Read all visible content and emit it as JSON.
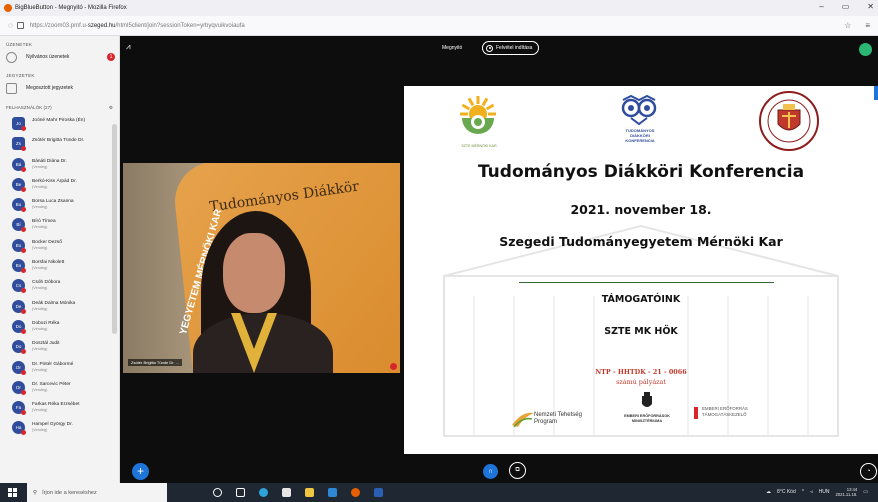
{
  "browser": {
    "window_title": "BigBlueButton - Megnyitó - Mozilla Firefox",
    "url_prefix": "https://",
    "url_host_pre": "zoom03.pmf.u-",
    "url_host": "szeged.hu",
    "url_path": "/html5client/join?sessionToken=yrbyqvuikvoiaufa"
  },
  "sidebar": {
    "messages_title": "ÜZENETEK",
    "public_chat_label": "Nyilvános üzenetek",
    "public_chat_badge": "1",
    "notes_title": "JEGYZETEK",
    "shared_notes_label": "Megosztott jegyzetek",
    "users_title": "FELHASZNÁLÓK (27)",
    "users": [
      {
        "initials": "Jo",
        "name": "Joóné Mahr Piroska (Én)",
        "role": "",
        "square": true
      },
      {
        "initials": "Zs",
        "name": "Zsótér Brigitta Tünde Dr.",
        "role": "",
        "square": true
      },
      {
        "initials": "Bá",
        "name": "Bánáti Diána Dr.",
        "role": "(Vendég)",
        "square": false
      },
      {
        "initials": "Be",
        "name": "Berkó-Kiss Árpád Dr.",
        "role": "(Vendég)",
        "square": false
      },
      {
        "initials": "Bo",
        "name": "Borsa Luca Zsanna",
        "role": "(Vendég)",
        "square": false
      },
      {
        "initials": "Bí",
        "name": "Bíró Tímea",
        "role": "(Vendég)",
        "square": false
      },
      {
        "initials": "Bo",
        "name": "Bocker Dezső",
        "role": "(Vendég)",
        "square": false
      },
      {
        "initials": "Bo",
        "name": "Borsfai Nikolett",
        "role": "(Vendég)",
        "square": false
      },
      {
        "initials": "Cs",
        "name": "Csóh Dóbora",
        "role": "(Vendég)",
        "square": false
      },
      {
        "initials": "De",
        "name": "Deák Dalma Mónika",
        "role": "(Vendég)",
        "square": false
      },
      {
        "initials": "Do",
        "name": "Dobozi Réka",
        "role": "(Vendég)",
        "square": false
      },
      {
        "initials": "Do",
        "name": "Dosztál Judit",
        "role": "(Vendég)",
        "square": false
      },
      {
        "initials": "Dr",
        "name": "Dr. Pintér Gábormé",
        "role": "(Vendég)",
        "square": false
      },
      {
        "initials": "Dr",
        "name": "Dr. Sarcevic Péter",
        "role": "(Vendég)",
        "square": false
      },
      {
        "initials": "Fa",
        "name": "Farkas Réka Erzsébet",
        "role": "(Vendég)",
        "square": false
      },
      {
        "initials": "Ha",
        "name": "Hampel György Dr.",
        "role": "(Vendég)",
        "square": false
      }
    ]
  },
  "meeting": {
    "name": "Megnyitó",
    "record_button": "Felvétel indítása"
  },
  "video": {
    "participant_label": "Zsótér Brigitta Tünde Dr. ...",
    "banner_text": "Tudományos Diákkör",
    "vertical_text": "YEGYETEM MÉRNÖKI KAR"
  },
  "slide": {
    "logo_labels": [
      "SZTE MÉRNÖKI KAR",
      "TUDOMÁNYOS DIÁKKÖRI KONFERENCIA"
    ],
    "title": "Tudományos Diákköri Konferencia",
    "date": "2021. november 18.",
    "faculty": "Szegedi Tudományegyetem Mérnöki Kar",
    "sponsors_heading": "TÁMOGATÓINK",
    "sponsor_hok": "SZTE MK HÖK",
    "ntp_line": "NTP - HHTDK - 21 - 0066",
    "ntp_sub": "számú pályázat",
    "sponsor_logos": [
      "Nemzeti Tehetség Program",
      "EMBERI ERŐFORRÁSOK MINISZTÉRIUMA",
      "EMBERI ERŐFORRÁS TÁMOGATÁSKEZELŐ"
    ]
  },
  "taskbar": {
    "search_placeholder": "Írjon ide a kereséshez",
    "weather": "8°C Köd",
    "lang": "HUN",
    "time": "13:44",
    "date": "2021.11.18."
  },
  "colors": {
    "accent": "#1e74d9",
    "badge": "#d7262e",
    "avatar": "#2f4d9c"
  }
}
